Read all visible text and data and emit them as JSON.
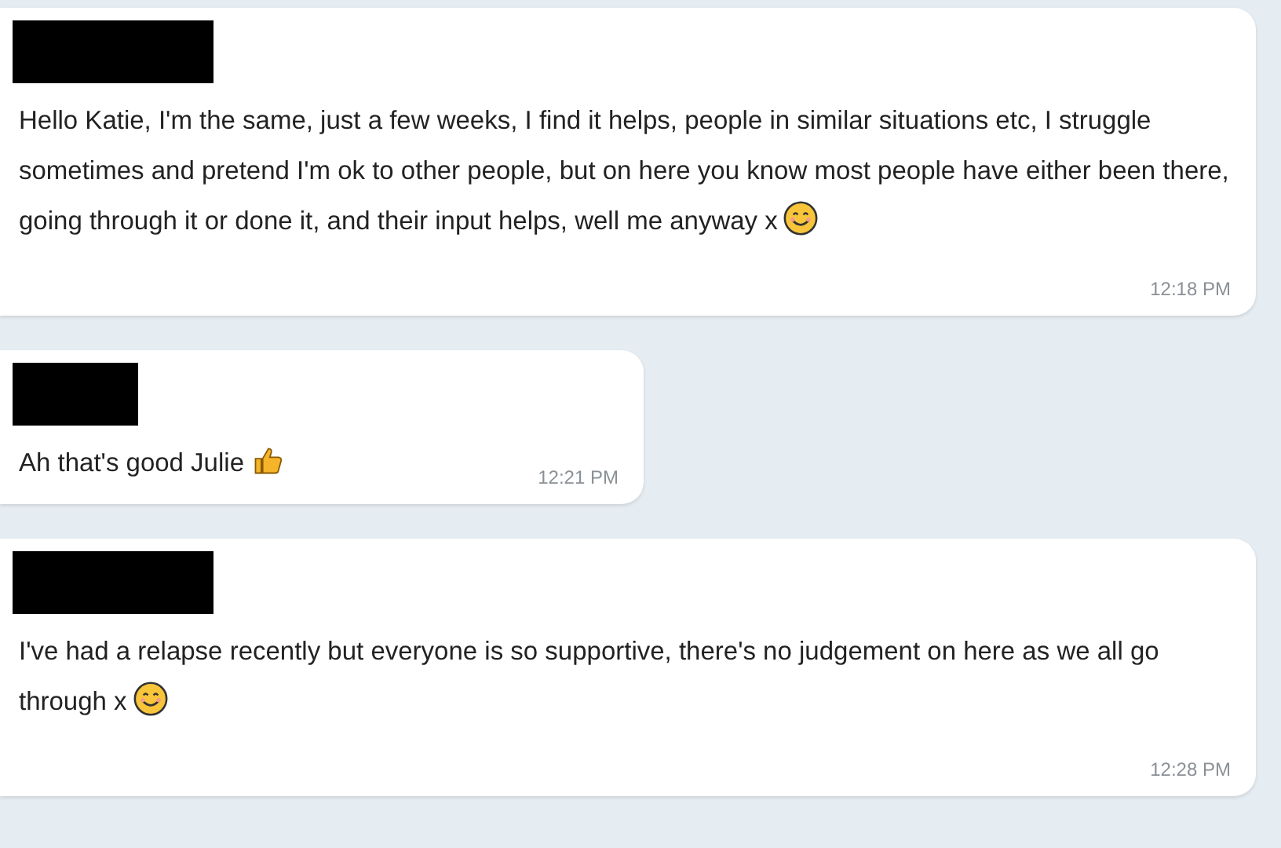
{
  "messages": [
    {
      "text": "Hello Katie, I'm the same, just a few weeks, I find it helps, people in similar situations etc, I struggle sometimes and pretend I'm ok to other people, but on here you know most people have either been there,  going through it or done it, and their input helps, well me anyway x",
      "kind": "smile",
      "time": "12:18 PM",
      "wide": true
    },
    {
      "text": "Ah that's good Julie",
      "kind": "thumbs",
      "time": "12:21 PM",
      "wide": false
    },
    {
      "text": "I've had a relapse recently but everyone is so supportive, there's no judgement on here as we all go through x",
      "kind": "smile",
      "time": "12:28 PM",
      "wide": true
    }
  ]
}
